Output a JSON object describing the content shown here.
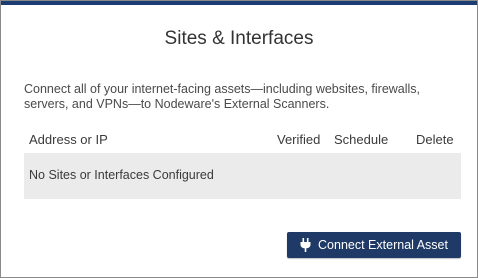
{
  "panel": {
    "title": "Sites & Interfaces",
    "description": "Connect all of your internet-facing assets—including websites, firewalls, servers, and VPNs—to Nodeware's External Scanners."
  },
  "table": {
    "columns": {
      "address": "Address or IP",
      "verified": "Verified",
      "schedule": "Schedule",
      "delete": "Delete"
    },
    "empty_message": "No Sites or Interfaces Configured"
  },
  "actions": {
    "connect_label": "Connect External Asset",
    "connect_icon": "plug-icon"
  },
  "colors": {
    "accent": "#1c3d73",
    "button": "#1f3a66",
    "empty_row_bg": "#ebebeb"
  }
}
